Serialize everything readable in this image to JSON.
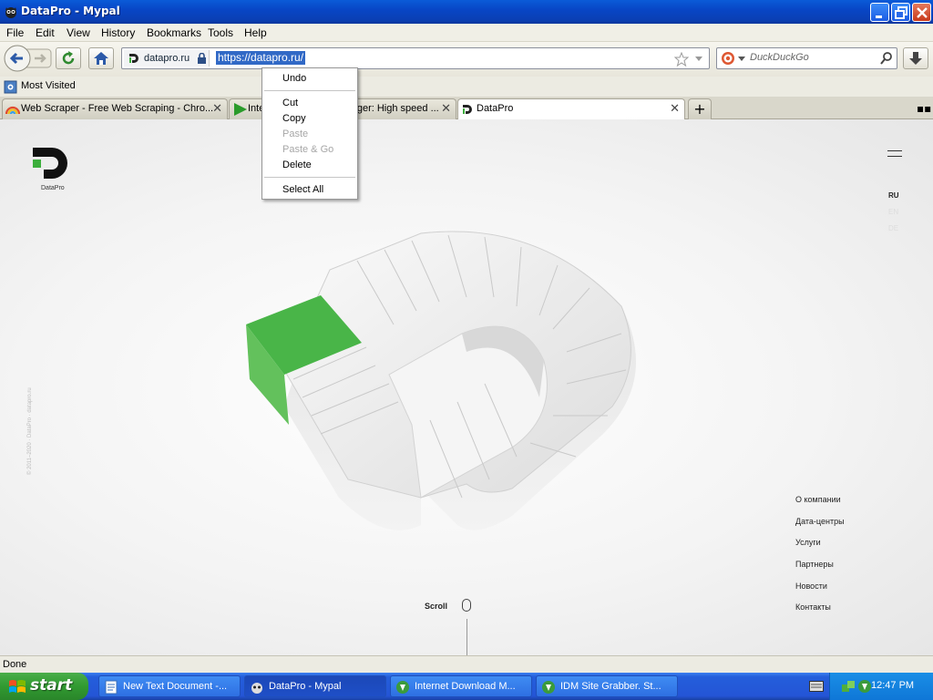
{
  "window": {
    "title": "DataPro - Mypal"
  },
  "menu": {
    "items": [
      "File",
      "Edit",
      "View",
      "History",
      "Bookmarks",
      "Tools",
      "Help"
    ]
  },
  "navbar": {
    "site_identity": "datapro.ru",
    "url": "https://datapro.ru/",
    "search_placeholder": "DuckDuckGo"
  },
  "bookmarks": {
    "most_visited": "Most Visited"
  },
  "tabs": [
    {
      "label": "Web Scraper - Free Web Scraping - Chro...",
      "icon": "rainbow-icon"
    },
    {
      "label": "Internet Download Manager: High speed ...",
      "icon": "play-arrow-icon"
    },
    {
      "label": "DataPro",
      "icon": "datapro-icon",
      "active": true
    }
  ],
  "context_menu": {
    "items": [
      "Undo",
      "Cut",
      "Copy",
      "Paste",
      "Paste & Go",
      "Delete",
      "Select All"
    ],
    "disabled": [
      "Paste",
      "Paste & Go"
    ]
  },
  "page": {
    "logo_label": "DataPro",
    "languages": [
      "RU",
      "EN",
      "DE"
    ],
    "nav": [
      "О компании",
      "Дата-центры",
      "Услуги",
      "Партнеры",
      "Новости",
      "Контакты"
    ],
    "scroll_label": "Scroll",
    "colors": {
      "accent_green": "#3cae3c"
    }
  },
  "status": {
    "text": "Done"
  },
  "taskbar": {
    "start_label": "start",
    "tasks": [
      {
        "label": "New Text Document -...",
        "icon": "notepad-icon"
      },
      {
        "label": "DataPro - Mypal",
        "icon": "mypal-icon",
        "active": true
      },
      {
        "label": "Internet Download M...",
        "icon": "idm-icon"
      },
      {
        "label": "IDM Site Grabber. St...",
        "icon": "idm-icon"
      }
    ],
    "clock": "12:47 PM"
  }
}
